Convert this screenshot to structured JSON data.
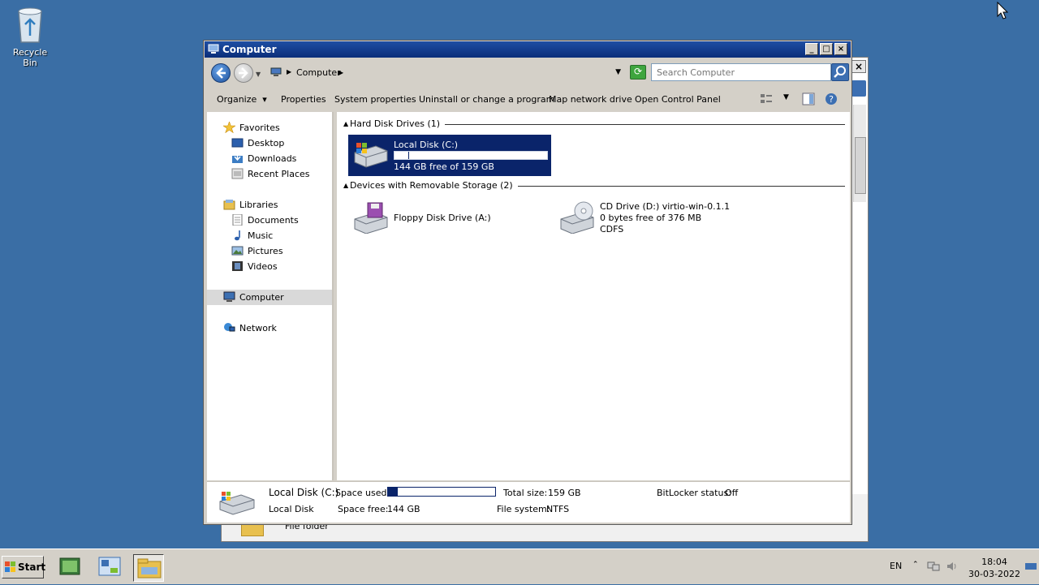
{
  "desktop": {
    "recycle_bin_label": "Recycle Bin"
  },
  "window": {
    "title": "Computer",
    "minimize": "_",
    "maximize": "□",
    "close": "×"
  },
  "address": {
    "crumb": "Computer",
    "search_placeholder": "Search Computer"
  },
  "toolbar": {
    "organize": "Organize",
    "properties": "Properties",
    "system_properties": "System properties",
    "uninstall": "Uninstall or change a program",
    "map_network_drive": "Map network drive",
    "open_control_panel": "Open Control Panel"
  },
  "nav": {
    "favorites": "Favorites",
    "desktop": "Desktop",
    "downloads": "Downloads",
    "recent_places": "Recent Places",
    "libraries": "Libraries",
    "documents": "Documents",
    "music": "Music",
    "pictures": "Pictures",
    "videos": "Videos",
    "computer": "Computer",
    "network": "Network"
  },
  "groups": {
    "hard_disk": "Hard Disk Drives (1)",
    "removable": "Devices with Removable Storage (2)"
  },
  "drives": {
    "c": {
      "name": "Local Disk (C:)",
      "free": "144 GB free of 159 GB",
      "used_fraction": 0.094
    },
    "a": {
      "name": "Floppy Disk Drive (A:)"
    },
    "d": {
      "name": "CD Drive (D:) virtio-win-0.1.1",
      "free": "0 bytes free of 376 MB",
      "fs": "CDFS"
    }
  },
  "details": {
    "name": "Local Disk (C:)",
    "type": "Local Disk",
    "space_used_label": "Space used:",
    "space_free_label": "Space free:",
    "space_free": "144 GB",
    "total_size_label": "Total size:",
    "total_size": "159 GB",
    "file_system_label": "File system:",
    "file_system": "NTFS",
    "bitlocker_label": "BitLocker status:",
    "bitlocker": "Off",
    "used_fraction": 0.094
  },
  "bg_window": {
    "footer_text": "File folder"
  },
  "taskbar": {
    "start": "Start",
    "lang": "EN",
    "time": "18:04",
    "date": "30-03-2022"
  }
}
